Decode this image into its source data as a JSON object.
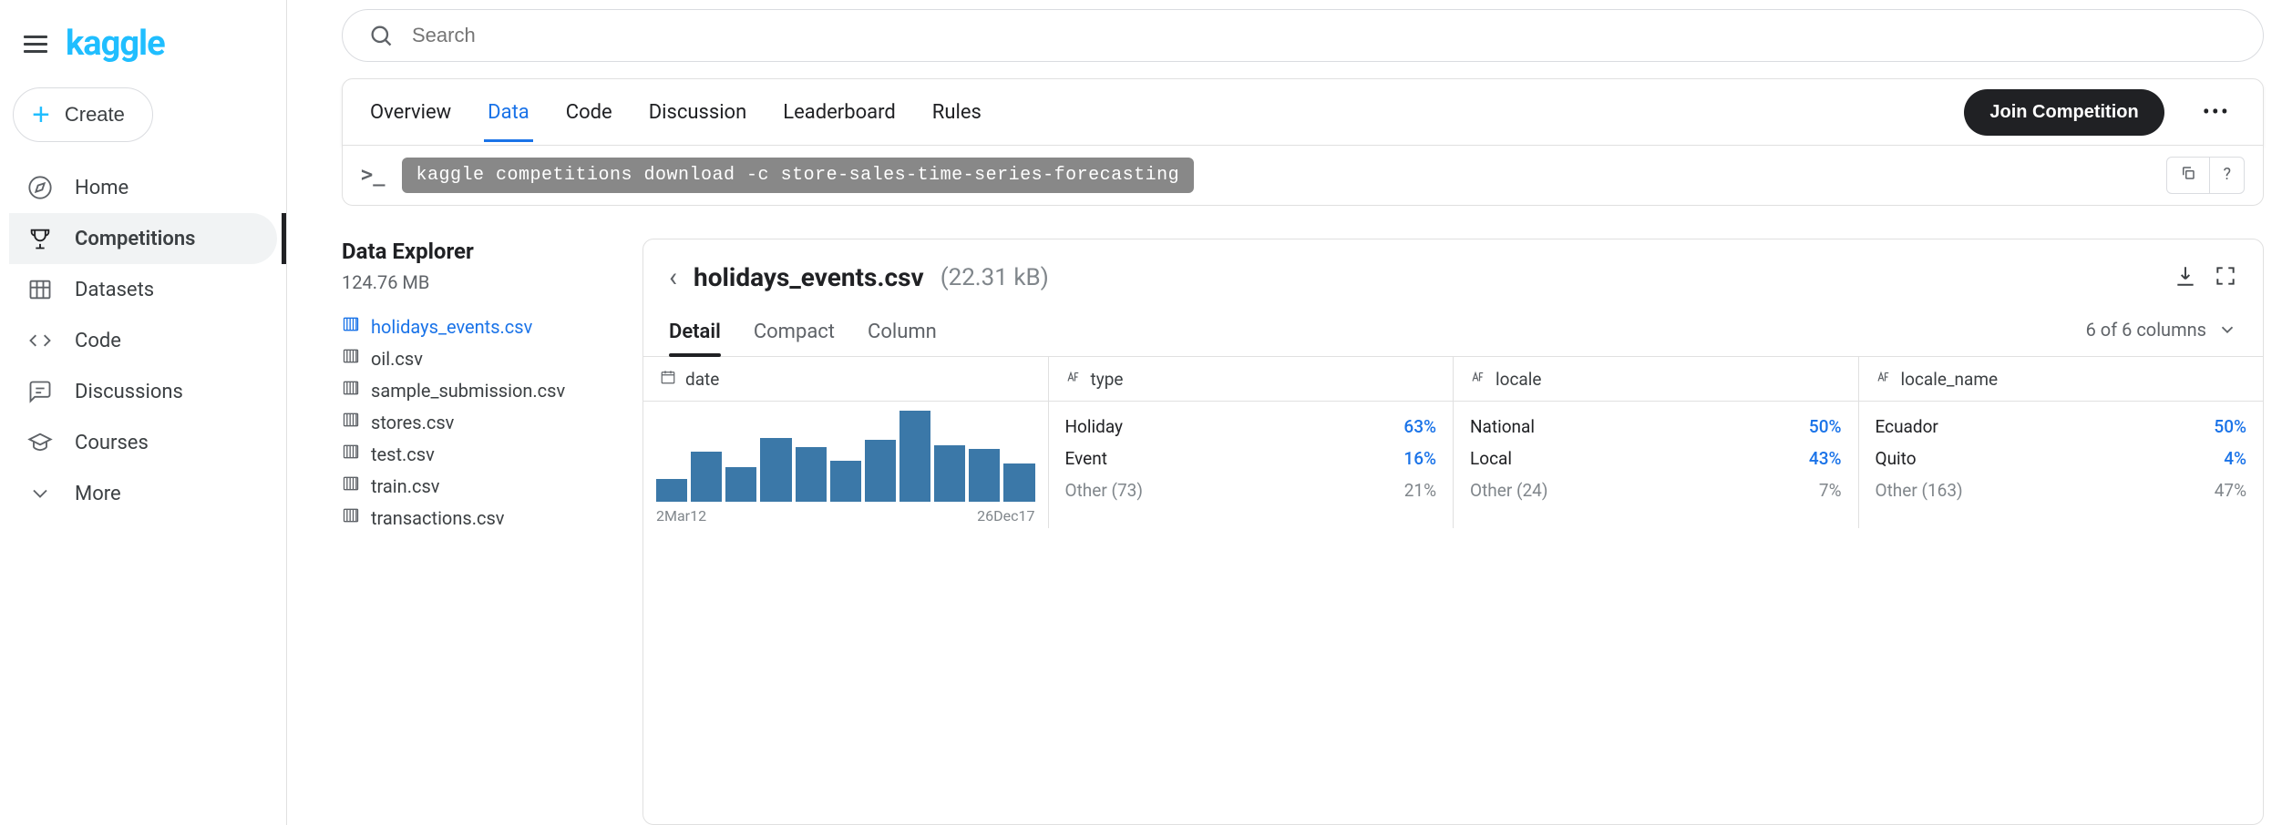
{
  "logo": "kaggle",
  "create_label": "Create",
  "search_placeholder": "Search",
  "nav": [
    {
      "label": "Home"
    },
    {
      "label": "Competitions"
    },
    {
      "label": "Datasets"
    },
    {
      "label": "Code"
    },
    {
      "label": "Discussions"
    },
    {
      "label": "Courses"
    },
    {
      "label": "More"
    }
  ],
  "tabs": {
    "overview": "Overview",
    "data": "Data",
    "code": "Code",
    "discussion": "Discussion",
    "leaderboard": "Leaderboard",
    "rules": "Rules"
  },
  "join_label": "Join Competition",
  "prompt": ">_",
  "cmd": "kaggle competitions download -c store-sales-time-series-forecasting",
  "help_char": "?",
  "explorer": {
    "title": "Data Explorer",
    "size": "124.76 MB",
    "files": [
      "holidays_events.csv",
      "oil.csv",
      "sample_submission.csv",
      "stores.csv",
      "test.csv",
      "train.csv",
      "transactions.csv"
    ]
  },
  "preview": {
    "filename": "holidays_events.csv",
    "filesize": "(22.31 kB)",
    "view_tabs": {
      "detail": "Detail",
      "compact": "Compact",
      "column": "Column"
    },
    "col_count": "6 of 6 columns",
    "columns": [
      {
        "name": "date",
        "type": "date",
        "histo_start": "2Mar12",
        "histo_end": "26Dec17"
      },
      {
        "name": "type",
        "type": "text",
        "dist": [
          {
            "label": "Holiday",
            "pct": "63%"
          },
          {
            "label": "Event",
            "pct": "16%"
          },
          {
            "label": "Other (73)",
            "pct": "21%",
            "other": true
          }
        ]
      },
      {
        "name": "locale",
        "type": "text",
        "dist": [
          {
            "label": "National",
            "pct": "50%"
          },
          {
            "label": "Local",
            "pct": "43%"
          },
          {
            "label": "Other (24)",
            "pct": "7%",
            "other": true
          }
        ]
      },
      {
        "name": "locale_name",
        "type": "text",
        "dist": [
          {
            "label": "Ecuador",
            "pct": "50%"
          },
          {
            "label": "Quito",
            "pct": "4%"
          },
          {
            "label": "Other (163)",
            "pct": "47%",
            "other": true
          }
        ]
      }
    ]
  },
  "chart_data": {
    "type": "bar",
    "title": "date distribution",
    "x_start": "2Mar12",
    "x_end": "26Dec17",
    "values": [
      25,
      55,
      38,
      70,
      60,
      45,
      68,
      100,
      62,
      58,
      42
    ]
  }
}
